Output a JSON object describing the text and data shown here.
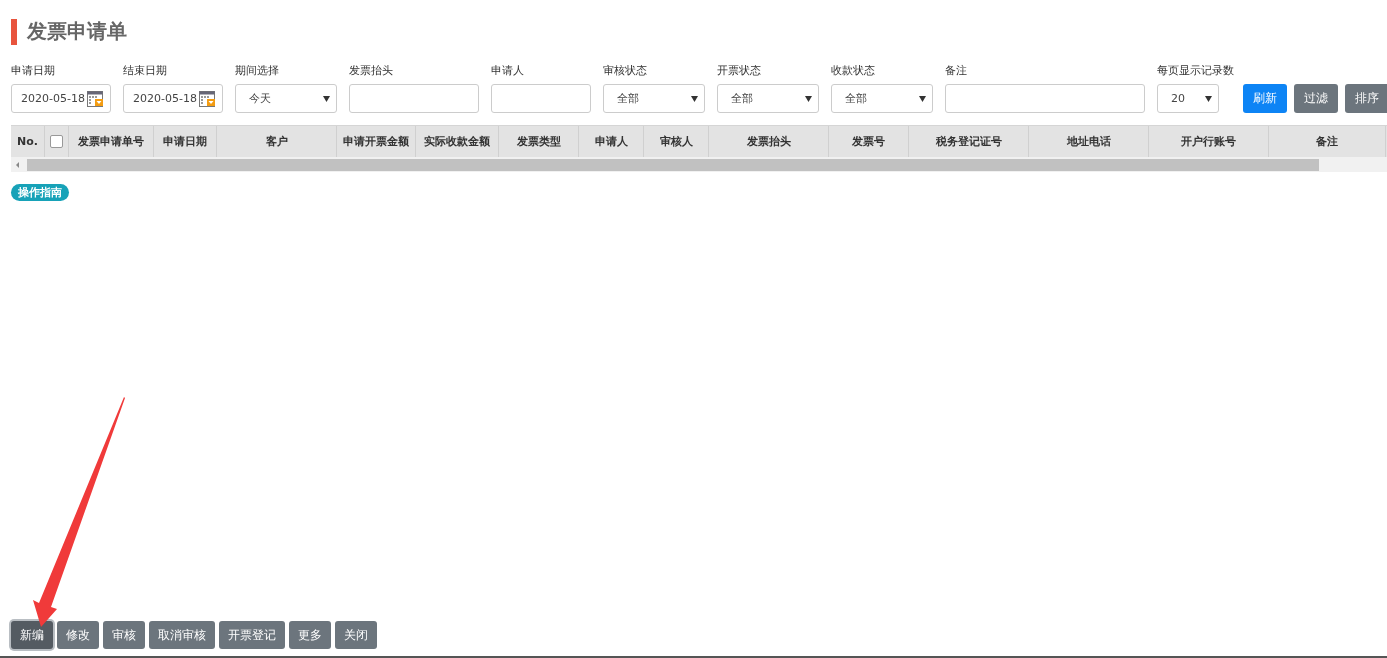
{
  "title": "发票申请单",
  "filters": [
    {
      "label": "申请日期",
      "kind": "date",
      "value": "2020-05-18"
    },
    {
      "label": "结束日期",
      "kind": "date",
      "value": "2020-05-18"
    },
    {
      "label": "期间选择",
      "kind": "select",
      "value": "今天"
    },
    {
      "label": "发票抬头",
      "kind": "text"
    },
    {
      "label": "申请人",
      "kind": "text"
    },
    {
      "label": "审核状态",
      "kind": "select",
      "value": "全部"
    },
    {
      "label": "开票状态",
      "kind": "select",
      "value": "全部"
    },
    {
      "label": "收款状态",
      "kind": "select",
      "value": "全部"
    },
    {
      "label": "备注",
      "kind": "wide"
    },
    {
      "label": "每页显示记录数",
      "kind": "small",
      "value": "20"
    }
  ],
  "filter_buttons": [
    {
      "label": "刷新",
      "kind": "primary"
    },
    {
      "label": "过滤",
      "kind": "secondary"
    },
    {
      "label": "排序",
      "kind": "secondary"
    }
  ],
  "table": {
    "columns": [
      {
        "label": "No.",
        "kind": "text"
      },
      {
        "kind": "checkbox",
        "checked": false
      },
      {
        "label": "发票申请单号",
        "kind": "text"
      },
      {
        "label": "申请日期",
        "kind": "text"
      },
      {
        "label": "客户",
        "kind": "text"
      },
      {
        "label": "申请开票金额",
        "kind": "text"
      },
      {
        "label": "实际收款金额",
        "kind": "text"
      },
      {
        "label": "发票类型",
        "kind": "text"
      },
      {
        "label": "申请人",
        "kind": "text"
      },
      {
        "label": "审核人",
        "kind": "text"
      },
      {
        "label": "发票抬头",
        "kind": "text"
      },
      {
        "label": "发票号",
        "kind": "text"
      },
      {
        "label": "税务登记证号",
        "kind": "text"
      },
      {
        "label": "地址电话",
        "kind": "text"
      },
      {
        "label": "开户行账号",
        "kind": "text"
      },
      {
        "label": "备注",
        "kind": "text"
      }
    ]
  },
  "guide_badge": "操作指南",
  "action_buttons": [
    {
      "label": "新编",
      "selected": true
    },
    {
      "label": "修改",
      "selected": false
    },
    {
      "label": "审核",
      "selected": false
    },
    {
      "label": "取消审核",
      "selected": false
    },
    {
      "label": "开票登记",
      "selected": false
    },
    {
      "label": "更多",
      "selected": false
    },
    {
      "label": "关闭",
      "selected": false
    }
  ]
}
